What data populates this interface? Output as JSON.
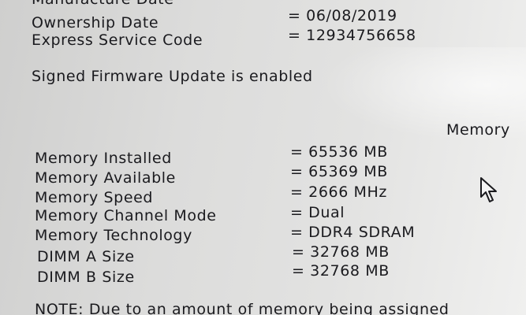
{
  "system_info": {
    "manufacture_date_label": "Manufacture Date",
    "ownership_date_label": "Ownership Date",
    "ownership_date_value": "= 06/08/2019",
    "express_service_code_label": "Express Service Code",
    "express_service_code_value": "= 12934756658"
  },
  "firmware": {
    "signed_update_status": "Signed Firmware Update is enabled"
  },
  "memory": {
    "section_header": "Memory",
    "rows": [
      {
        "label": "Memory Installed",
        "value": "= 65536 MB"
      },
      {
        "label": "Memory Available",
        "value": "= 65369 MB"
      },
      {
        "label": "Memory Speed",
        "value": "= 2666 MHz"
      },
      {
        "label": "Memory Channel Mode",
        "value": "= Dual"
      },
      {
        "label": "Memory Technology",
        "value": "= DDR4 SDRAM"
      },
      {
        "label": "DIMM A Size",
        "value": "= 32768 MB"
      },
      {
        "label": "DIMM B Size",
        "value": "= 32768 MB"
      }
    ]
  },
  "note": {
    "text": "NOTE: Due to an amount of memory being assigned"
  },
  "icons": {
    "cursor": "mouse-pointer-icon"
  }
}
